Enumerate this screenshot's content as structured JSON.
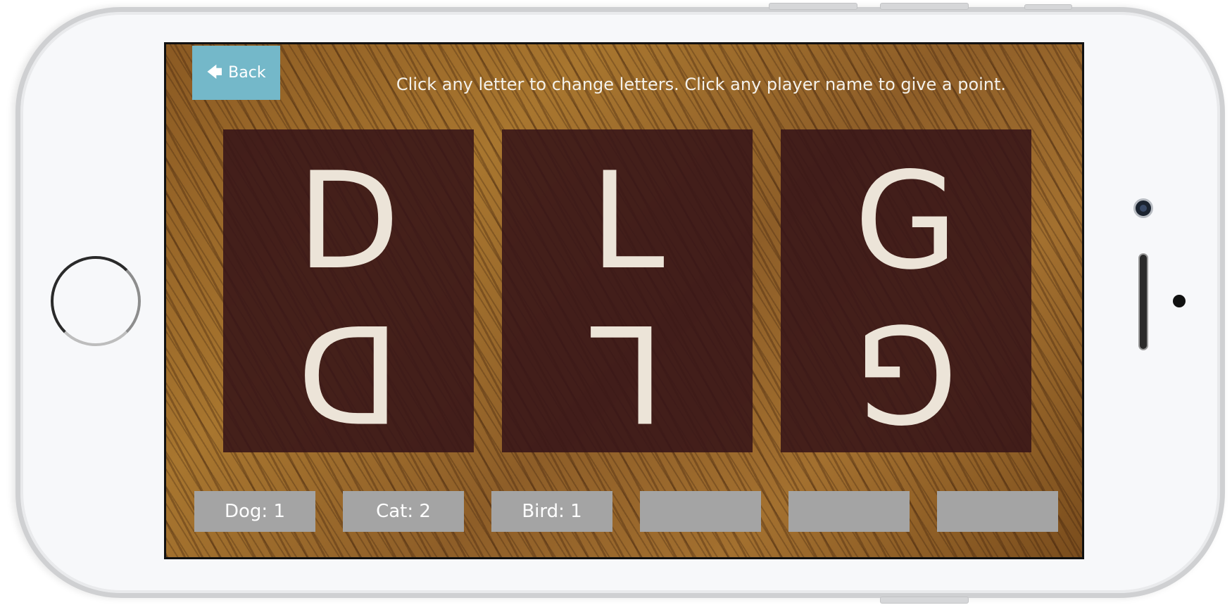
{
  "back_button": {
    "icon": "arrow-left-icon",
    "label": "Back"
  },
  "instructions": "Click any letter to change letters. Click any player name to give a point.",
  "tiles": [
    {
      "letter": "D"
    },
    {
      "letter": "L"
    },
    {
      "letter": "G"
    }
  ],
  "players": [
    {
      "label": "Dog: 1"
    },
    {
      "label": "Cat: 2"
    },
    {
      "label": "Bird: 1"
    },
    {
      "label": ""
    },
    {
      "label": ""
    },
    {
      "label": ""
    }
  ],
  "colors": {
    "back_button": "#74b8c9",
    "tile": "#37141a",
    "letter": "#ece4d8",
    "player_button": "#a4a4a4"
  }
}
